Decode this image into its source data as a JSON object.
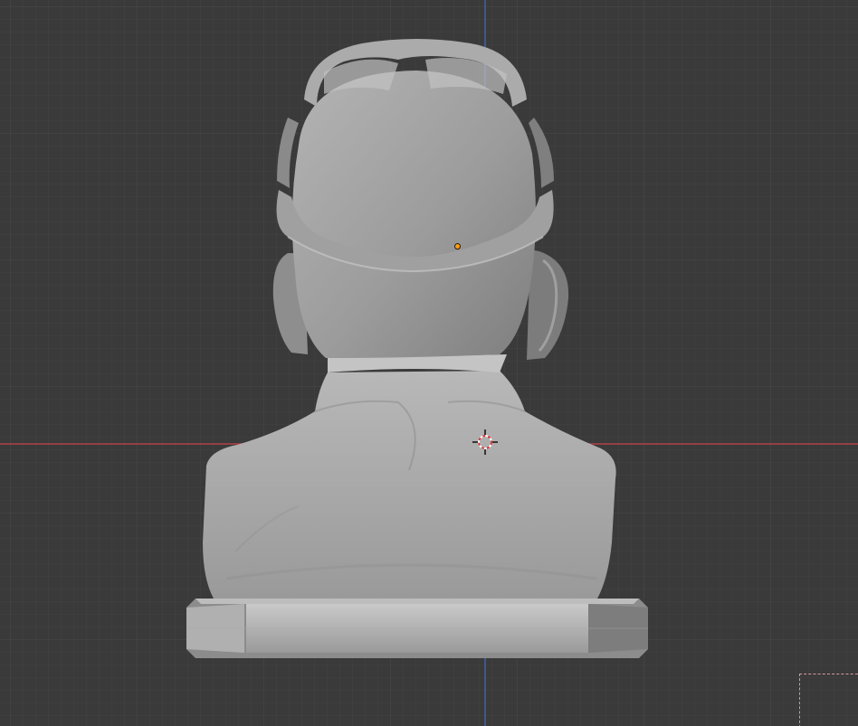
{
  "viewport": {
    "view": "back-orthographic",
    "object": "bust-with-goggles",
    "background_color": "#3a3a3a",
    "grid_minor_color": "#434343",
    "grid_major_color": "#4b4b4b",
    "x_axis_color": "#b0434b",
    "z_axis_color": "#3f63a8",
    "mesh_color": "#a6a6a6",
    "origin_color": "#ff9f1a",
    "cursor_icon": "3d-cursor-icon"
  }
}
